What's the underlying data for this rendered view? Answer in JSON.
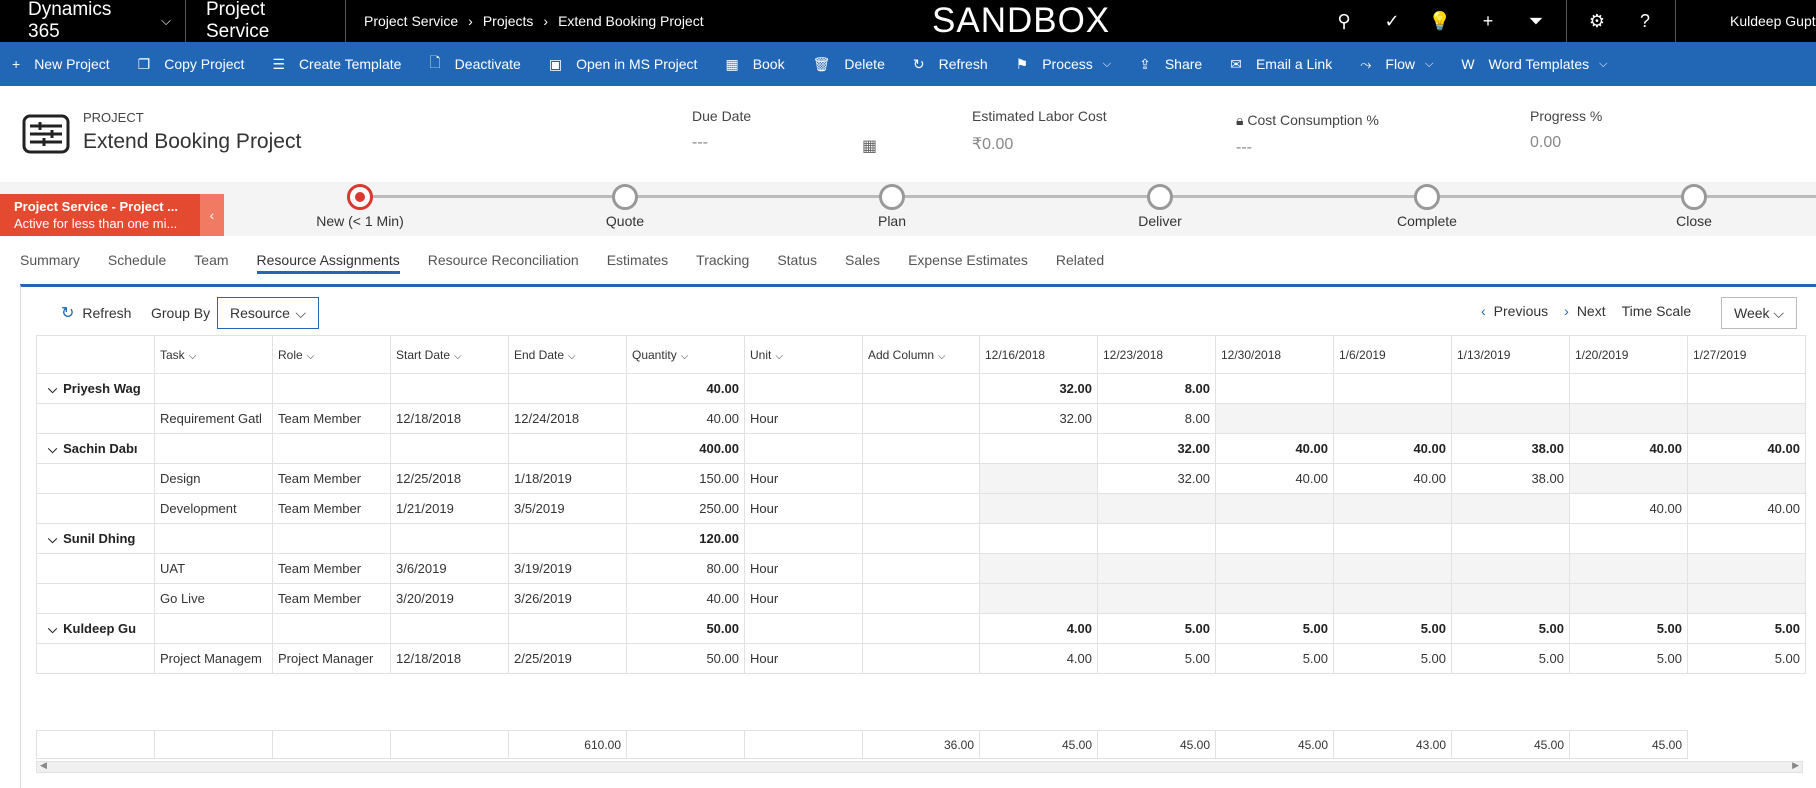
{
  "topnav": {
    "brand": "Dynamics 365",
    "app": "Project Service",
    "crumbs": [
      "Project Service",
      "Projects",
      "Extend Booking Project"
    ],
    "environment": "SANDBOX",
    "user": "Kuldeep Gupt"
  },
  "commands": [
    {
      "label": "New Project",
      "icon": "+"
    },
    {
      "label": "Copy Project",
      "icon": "❐"
    },
    {
      "label": "Create Template",
      "icon": "☰"
    },
    {
      "label": "Deactivate",
      "icon": "🗋"
    },
    {
      "label": "Open in MS Project",
      "icon": "▣"
    },
    {
      "label": "Book",
      "icon": "▦"
    },
    {
      "label": "Delete",
      "icon": "🗑"
    },
    {
      "label": "Refresh",
      "icon": "↻"
    },
    {
      "label": "Process",
      "icon": "⚑",
      "dropdown": true
    },
    {
      "label": "Share",
      "icon": "⇪"
    },
    {
      "label": "Email a Link",
      "icon": "✉"
    },
    {
      "label": "Flow",
      "icon": "⤳",
      "dropdown": true
    },
    {
      "label": "Word Templates",
      "icon": "W",
      "dropdown": true
    }
  ],
  "header": {
    "entity": "PROJECT",
    "name": "Extend Booking Project",
    "due_date_label": "Due Date",
    "due_date_value": "---",
    "labor_label": "Estimated Labor Cost",
    "labor_value": "₹0.00",
    "consumption_label": "Cost Consumption %",
    "consumption_value": "---",
    "progress_label": "Progress %",
    "progress_value": "0.00"
  },
  "process": {
    "title": "Project Service - Project ...",
    "subtitle": "Active for less than one mi...",
    "stages": [
      "New  (< 1 Min)",
      "Quote",
      "Plan",
      "Deliver",
      "Complete",
      "Close"
    ]
  },
  "tabs": [
    "Summary",
    "Schedule",
    "Team",
    "Resource Assignments",
    "Resource Reconciliation",
    "Estimates",
    "Tracking",
    "Status",
    "Sales",
    "Expense Estimates",
    "Related"
  ],
  "toolbar": {
    "refresh": "Refresh",
    "group_by": "Group By",
    "group_value": "Resource",
    "previous": "Previous",
    "next": "Next",
    "time_scale": "Time Scale",
    "time_value": "Week"
  },
  "grid": {
    "columns": [
      "Task",
      "Role",
      "Start Date",
      "End Date",
      "Quantity",
      "Unit",
      "Add Column"
    ],
    "weeks": [
      "12/16/2018",
      "12/23/2018",
      "12/30/2018",
      "1/6/2019",
      "1/13/2019",
      "1/20/2019",
      "1/27/2019"
    ],
    "rows": [
      {
        "type": "group",
        "resource": "Priyesh Wag",
        "quantity": "40.00",
        "weeks": [
          "32.00",
          "8.00",
          "",
          "",
          "",
          "",
          ""
        ]
      },
      {
        "type": "task",
        "task": "Requirement Gatl",
        "role": "Team Member",
        "start": "12/18/2018",
        "end": "12/24/2018",
        "quantity": "40.00",
        "unit": "Hour",
        "weeks": [
          "32.00",
          "8.00",
          "",
          "",
          "",
          "",
          ""
        ],
        "grey": [
          false,
          false,
          true,
          true,
          true,
          true,
          true
        ]
      },
      {
        "type": "group",
        "resource": "Sachin Dabı",
        "quantity": "400.00",
        "weeks": [
          "",
          "32.00",
          "40.00",
          "40.00",
          "38.00",
          "40.00",
          "40.00"
        ]
      },
      {
        "type": "task",
        "task": "Design",
        "role": "Team Member",
        "start": "12/25/2018",
        "end": "1/18/2019",
        "quantity": "150.00",
        "unit": "Hour",
        "weeks": [
          "",
          "32.00",
          "40.00",
          "40.00",
          "38.00",
          "",
          ""
        ],
        "grey": [
          true,
          false,
          false,
          false,
          false,
          true,
          true
        ]
      },
      {
        "type": "task",
        "task": "Development",
        "role": "Team Member",
        "start": "1/21/2019",
        "end": "3/5/2019",
        "quantity": "250.00",
        "unit": "Hour",
        "weeks": [
          "",
          "",
          "",
          "",
          "",
          "40.00",
          "40.00"
        ],
        "grey": [
          true,
          true,
          true,
          true,
          true,
          false,
          false
        ]
      },
      {
        "type": "group",
        "resource": "Sunil Dhing",
        "quantity": "120.00",
        "weeks": [
          "",
          "",
          "",
          "",
          "",
          "",
          ""
        ]
      },
      {
        "type": "task",
        "task": "UAT",
        "role": "Team Member",
        "start": "3/6/2019",
        "end": "3/19/2019",
        "quantity": "80.00",
        "unit": "Hour",
        "weeks": [
          "",
          "",
          "",
          "",
          "",
          "",
          ""
        ],
        "grey": [
          true,
          true,
          true,
          true,
          true,
          true,
          true
        ]
      },
      {
        "type": "task",
        "task": "Go Live",
        "role": "Team Member",
        "start": "3/20/2019",
        "end": "3/26/2019",
        "quantity": "40.00",
        "unit": "Hour",
        "weeks": [
          "",
          "",
          "",
          "",
          "",
          "",
          ""
        ],
        "grey": [
          true,
          true,
          true,
          true,
          true,
          true,
          true
        ]
      },
      {
        "type": "group",
        "resource": "Kuldeep Gu",
        "quantity": "50.00",
        "weeks": [
          "4.00",
          "5.00",
          "5.00",
          "5.00",
          "5.00",
          "5.00",
          "5.00"
        ]
      },
      {
        "type": "task",
        "task": "Project Managem",
        "role": "Project Manager",
        "start": "12/18/2018",
        "end": "2/25/2019",
        "quantity": "50.00",
        "unit": "Hour",
        "weeks": [
          "4.00",
          "5.00",
          "5.00",
          "5.00",
          "5.00",
          "5.00",
          "5.00"
        ],
        "grey": [
          false,
          false,
          false,
          false,
          false,
          false,
          false
        ]
      }
    ],
    "totals": {
      "quantity": "610.00",
      "weeks": [
        "36.00",
        "45.00",
        "45.00",
        "45.00",
        "43.00",
        "45.00",
        "45.00"
      ]
    }
  }
}
